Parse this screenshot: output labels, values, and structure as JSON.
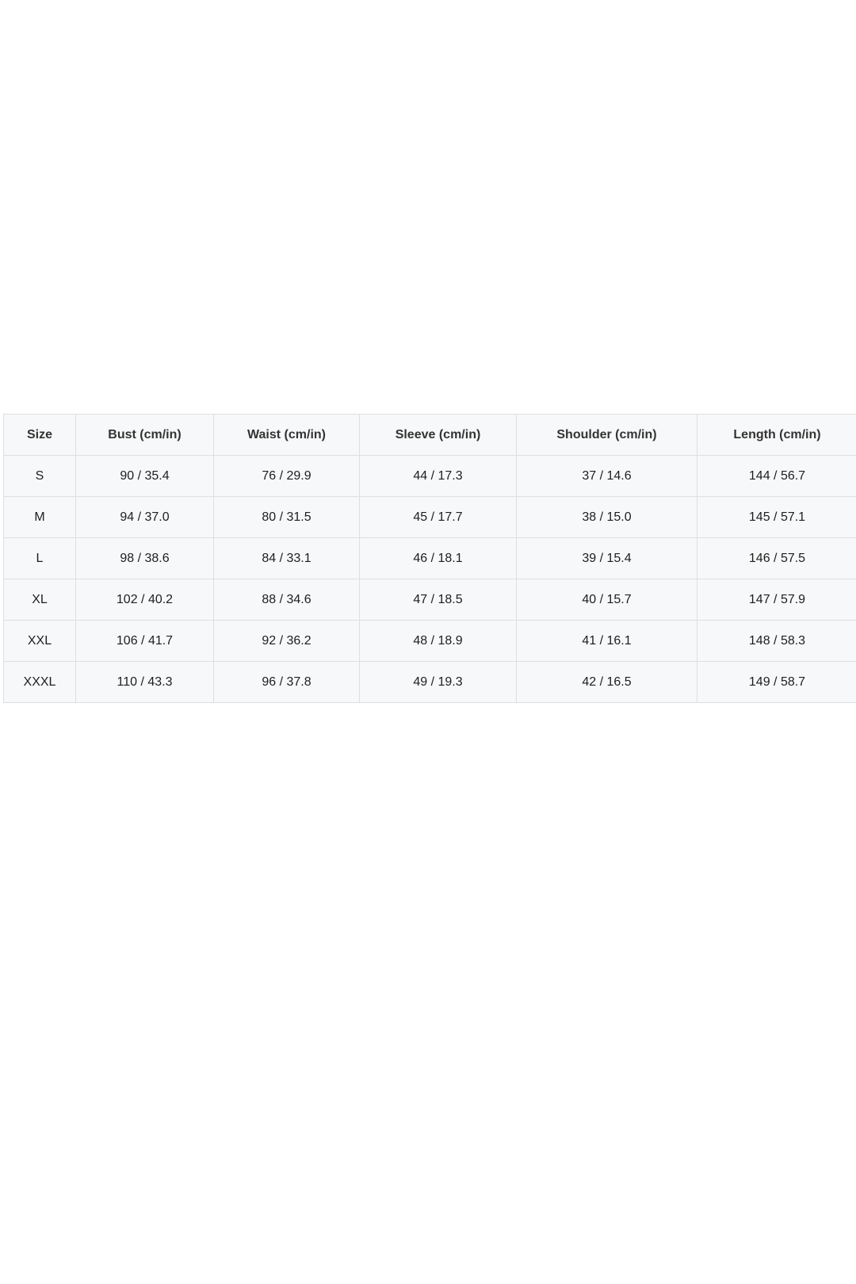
{
  "size_chart": {
    "columns": [
      "Size",
      "Bust (cm/in)",
      "Waist (cm/in)",
      "Sleeve (cm/in)",
      "Shoulder (cm/in)",
      "Length (cm/in)"
    ],
    "rows": [
      [
        "S",
        "90 / 35.4",
        "76 / 29.9",
        "44 / 17.3",
        "37 / 14.6",
        "144 / 56.7"
      ],
      [
        "M",
        "94 / 37.0",
        "80 / 31.5",
        "45 / 17.7",
        "38 / 15.0",
        "145 / 57.1"
      ],
      [
        "L",
        "98 / 38.6",
        "84 / 33.1",
        "46 / 18.1",
        "39 / 15.4",
        "146 / 57.5"
      ],
      [
        "XL",
        "102 / 40.2",
        "88 / 34.6",
        "47 / 18.5",
        "40 / 15.7",
        "147 / 57.9"
      ],
      [
        "XXL",
        "106 / 41.7",
        "92 / 36.2",
        "48 / 18.9",
        "41 / 16.1",
        "148 / 58.3"
      ],
      [
        "XXXL",
        "110 / 43.3",
        "96 / 37.8",
        "49 / 19.3",
        "42 / 16.5",
        "149 / 58.7"
      ]
    ]
  }
}
